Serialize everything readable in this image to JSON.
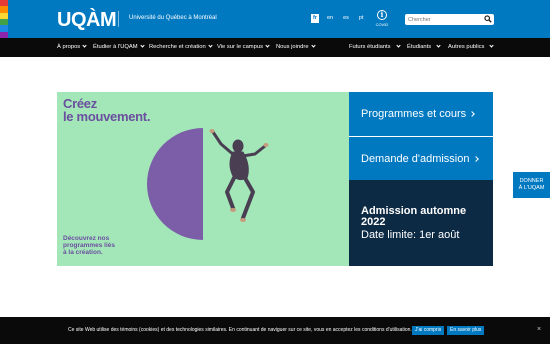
{
  "header": {
    "logo": "UQÀM",
    "university": "Université du Québec à Montréal",
    "languages": [
      {
        "label": "fr",
        "active": true
      },
      {
        "label": "en",
        "active": false
      },
      {
        "label": "es",
        "active": false
      },
      {
        "label": "pt",
        "active": false
      }
    ],
    "covid_label": "COVID",
    "covid_icon": "info-icon",
    "search_placeholder": "Chercher",
    "search_icon": "search-icon",
    "rainbow": [
      "#e53935",
      "#fb8c00",
      "#fdd835",
      "#43a047",
      "#1e88e5",
      "#8e24aa"
    ]
  },
  "nav": {
    "items": [
      {
        "label": "À propos"
      },
      {
        "label": "Étudier à l'UQAM"
      },
      {
        "label": "Recherche et création"
      },
      {
        "label": "Vie sur le campus"
      },
      {
        "label": "Nous joindre"
      },
      {
        "label": "Futurs étudiants"
      },
      {
        "label": "Étudiants"
      },
      {
        "label": "Autres publics"
      }
    ]
  },
  "hero": {
    "title_line1": "Créez",
    "title_line2": "le mouvement.",
    "sub_line1": "Découvrez nos",
    "sub_line2": "programmes liés",
    "sub_line3": "à la création."
  },
  "panels": {
    "programmes": "Programmes et cours",
    "admission": "Demande d'admission",
    "auto_title_1": "Admission automne",
    "auto_title_2": "2022",
    "auto_date": "Date limite: 1er août"
  },
  "donate": {
    "line1": "DONNER",
    "line2": "À L'UQAM"
  },
  "cookie": {
    "text": "Ce site Web utilise des témoins (cookies) et des technologies similaires. En continuant de naviguer sur ce site, vous en acceptez les conditions d'utilisation.",
    "accept": "J'ai compris",
    "more": "En savoir plus",
    "close": "×"
  },
  "colors": {
    "brand_blue": "#0079c1",
    "dark_navy": "#0d2a44",
    "hero_green": "#a3e7b9",
    "hero_purple": "#6b4f9f"
  }
}
